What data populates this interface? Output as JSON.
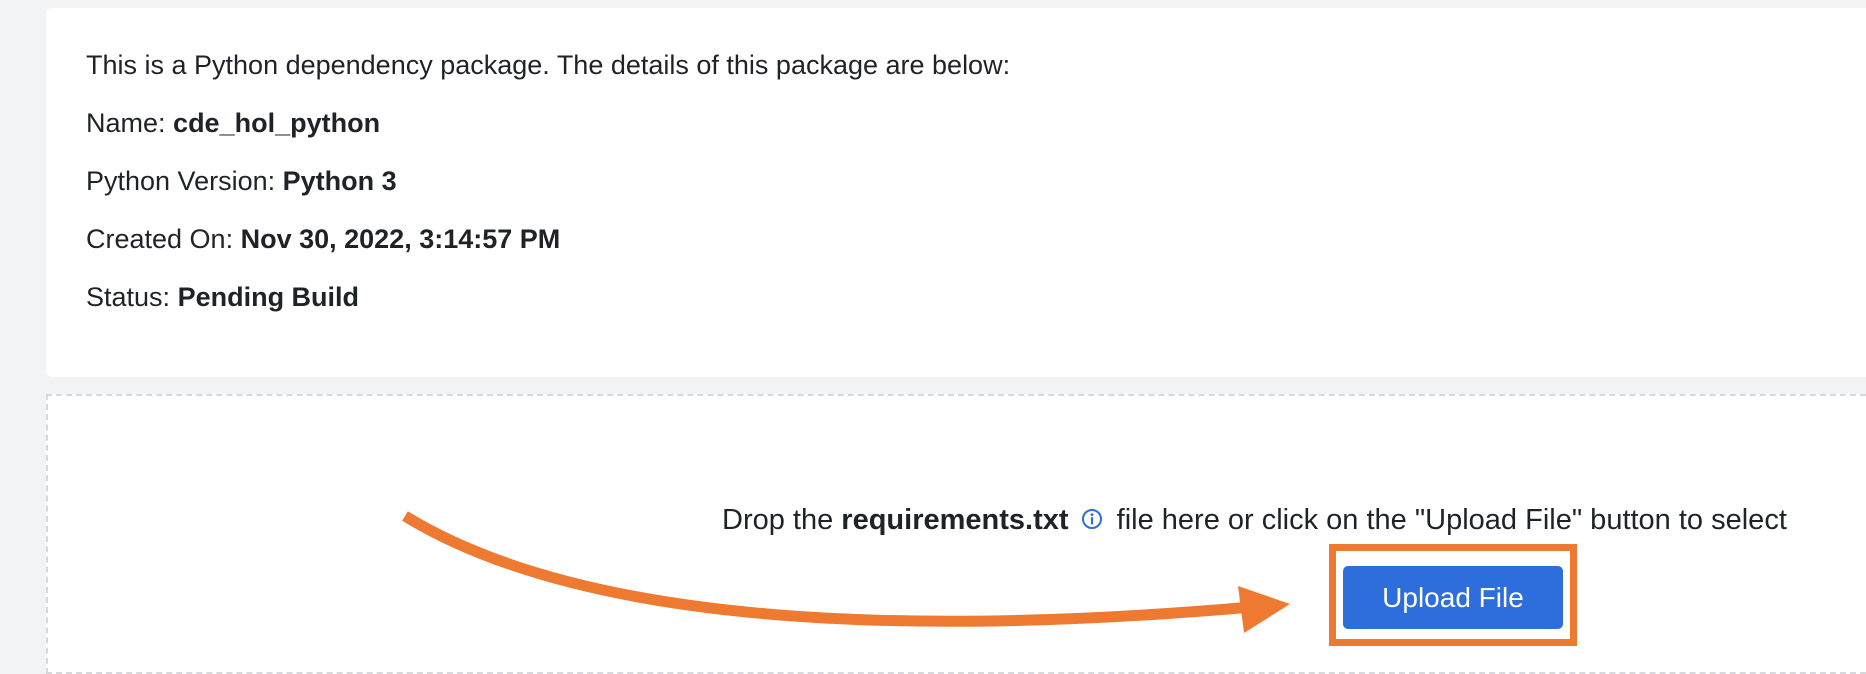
{
  "package_details": {
    "intro": "This is a Python dependency package. The details of this package are below:",
    "name_label": "Name:",
    "name_value": "cde_hol_python",
    "python_version_label": "Python Version:",
    "python_version_value": "Python 3",
    "created_on_label": "Created On:",
    "created_on_value": "Nov 30, 2022, 3:14:57 PM",
    "status_label": "Status:",
    "status_value": "Pending Build"
  },
  "dropzone": {
    "text_before": "Drop the",
    "filename": "requirements.txt",
    "info_icon": "info-circle-icon",
    "text_after": "file here or click on the \"Upload File\" button to select",
    "upload_button_label": "Upload File"
  },
  "annotation": {
    "highlight_color": "#ee7a31",
    "arrow_color": "#ee7a31"
  },
  "colors": {
    "primary_button": "#2e6ddc",
    "background": "#f2f3f5",
    "card": "#ffffff"
  }
}
